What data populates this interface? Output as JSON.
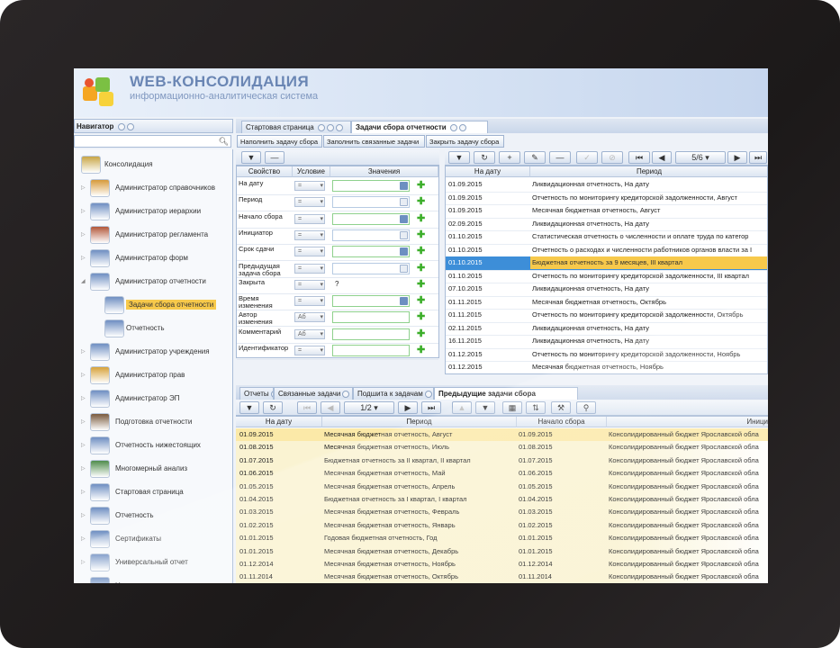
{
  "app": {
    "title": "WEB-КОНСОЛИДАЦИЯ",
    "subtitle": "информационно-аналитическая система"
  },
  "navigator": {
    "title": "Навигатор",
    "items": [
      {
        "label": "Консолидация",
        "icon": "consolidation-icon",
        "color": "#c9a646"
      },
      {
        "label": "Администратор справочников",
        "icon": "admin-user-icon",
        "color": "#d79a3b"
      },
      {
        "label": "Администратор иерархии",
        "icon": "admin-user-icon",
        "color": "#6f8fc2"
      },
      {
        "label": "Администратор регламента",
        "icon": "admin-user-icon",
        "color": "#b2573a"
      },
      {
        "label": "Администратор форм",
        "icon": "admin-user-icon",
        "color": "#6f8fc2"
      },
      {
        "label": "Администратор отчетности",
        "icon": "admin-user-icon",
        "color": "#6f8fc2"
      },
      {
        "label": "Задачи сбора отчетности",
        "icon": "task-icon",
        "color": "#6f8fc2"
      },
      {
        "label": "Отчетность",
        "icon": "report-icon",
        "color": "#6f8fc2"
      },
      {
        "label": "Администратор учреждения",
        "icon": "admin-user-icon",
        "color": "#6f8fc2"
      },
      {
        "label": "Администратор прав",
        "icon": "admin-user-icon",
        "color": "#d7a23b"
      },
      {
        "label": "Администратор ЭП",
        "icon": "admin-user-icon",
        "color": "#6f8fc2"
      },
      {
        "label": "Подготовка отчетности",
        "icon": "prepare-icon",
        "color": "#7a5a3e"
      },
      {
        "label": "Отчетность нижестоящих",
        "icon": "tree-icon",
        "color": "#6f8fc2"
      },
      {
        "label": "Многомерный анализ",
        "icon": "cube-icon",
        "color": "#4f8c4c"
      },
      {
        "label": "Стартовая страница",
        "icon": "home-icon",
        "color": "#6f8fc2"
      },
      {
        "label": "Отчетность",
        "icon": "report-icon",
        "color": "#6f8fc2"
      },
      {
        "label": "Сертификаты",
        "icon": "certificate-icon",
        "color": "#6f8fc2"
      },
      {
        "label": "Универсальный отчет",
        "icon": "table-icon",
        "color": "#6f8fc2"
      },
      {
        "label": "Новости",
        "icon": "news-icon",
        "color": "#6f8fc2"
      }
    ]
  },
  "tabs": {
    "start": "Стартовая страница",
    "tasks": "Задачи сбора отчетности"
  },
  "actions": {
    "fill": "Наполнить задачу сбора",
    "fill_related": "Заполнить связанные задачи",
    "close": "Закрыть задачу сбора"
  },
  "filter": {
    "columns": [
      "Свойство",
      "Условие",
      "Значения"
    ],
    "rows": [
      {
        "prop": "На дату",
        "cond": "=",
        "value": "",
        "kind": "date"
      },
      {
        "prop": "Период",
        "cond": "=",
        "value": "",
        "kind": "select"
      },
      {
        "prop": "Начало сбора",
        "cond": "=",
        "value": "",
        "kind": "date"
      },
      {
        "prop": "Инициатор",
        "cond": "=",
        "value": "",
        "kind": "lookup"
      },
      {
        "prop": "Срок сдачи",
        "cond": "=",
        "value": "",
        "kind": "date"
      },
      {
        "prop": "Предыдущая задача сбора",
        "cond": "=",
        "value": "",
        "kind": "lookup"
      },
      {
        "prop": "Закрыта",
        "cond": "=",
        "value": "?",
        "kind": "bool"
      },
      {
        "prop": "Время изменения",
        "cond": "=",
        "value": "",
        "kind": "date"
      },
      {
        "prop": "Автор изменения",
        "cond": "Аб",
        "value": "",
        "kind": "text"
      },
      {
        "prop": "Комментарий",
        "cond": "Аб",
        "value": "",
        "kind": "text"
      },
      {
        "prop": "Идентификатор",
        "cond": "=",
        "value": "",
        "kind": "text"
      }
    ]
  },
  "pager_top": "5/6",
  "grid_top": {
    "columns": [
      "На дату",
      "Период"
    ],
    "rows": [
      {
        "date": "01.09.2015",
        "period": "Ликвидационная отчетность, На дату"
      },
      {
        "date": "01.09.2015",
        "period": "Отчетность по мониторингу кредиторской задолженности, Август"
      },
      {
        "date": "01.09.2015",
        "period": "Месячная бюджетная отчетность, Август"
      },
      {
        "date": "02.09.2015",
        "period": "Ликвидационная отчетность, На дату"
      },
      {
        "date": "01.10.2015",
        "period": "Статистическая отчетность о численности и оплате труда по категор"
      },
      {
        "date": "01.10.2015",
        "period": "Отчетность о расходах и численности работников органов власти за I"
      },
      {
        "date": "01.10.2015",
        "period": "Бюджетная отчетность за 9 месяцев, III квартал"
      },
      {
        "date": "01.10.2015",
        "period": "Отчетность по мониторингу кредиторской задолженности, III квартал"
      },
      {
        "date": "07.10.2015",
        "period": "Ликвидационная отчетность, На дату"
      },
      {
        "date": "01.11.2015",
        "period": "Месячная бюджетная отчетность, Октябрь"
      },
      {
        "date": "01.11.2015",
        "period": "Отчетность по мониторингу кредиторской задолженности, Октябрь"
      },
      {
        "date": "02.11.2015",
        "period": "Ликвидационная отчетность, На дату"
      },
      {
        "date": "16.11.2015",
        "period": "Ликвидационная отчетность, На дату"
      },
      {
        "date": "01.12.2015",
        "period": "Отчетность по мониторингу кредиторской задолженности, Ноябрь"
      },
      {
        "date": "01.12.2015",
        "period": "Месячная бюджетная отчетность, Ноябрь"
      }
    ],
    "selected_index": 6
  },
  "bottom_tabs": [
    "Отчеты",
    "Связанные задачи",
    "Подшита к задачам",
    "Предыдущие задачи сбора"
  ],
  "pager_bottom": "1/2",
  "grid_bottom": {
    "columns": [
      "На дату",
      "Период",
      "Начало сбора",
      "Иници"
    ],
    "rows": [
      {
        "date": "01.09.2015",
        "period": "Месячная бюджетная отчетность, Август",
        "start": "01.09.2015",
        "init": "Консолидированный бюджет Ярославской обла"
      },
      {
        "date": "01.08.2015",
        "period": "Месячная бюджетная отчетность, Июль",
        "start": "01.08.2015",
        "init": "Консолидированный бюджет Ярославской обла"
      },
      {
        "date": "01.07.2015",
        "period": "Бюджетная отчетность за II квартал, II квартал",
        "start": "01.07.2015",
        "init": "Консолидированный бюджет Ярославской обла"
      },
      {
        "date": "01.06.2015",
        "period": "Месячная бюджетная отчетность, Май",
        "start": "01.06.2015",
        "init": "Консолидированный бюджет Ярославской обла"
      },
      {
        "date": "01.05.2015",
        "period": "Месячная бюджетная отчетность, Апрель",
        "start": "01.05.2015",
        "init": "Консолидированный бюджет Ярославской обла"
      },
      {
        "date": "01.04.2015",
        "period": "Бюджетная отчетность за I квартал, I квартал",
        "start": "01.04.2015",
        "init": "Консолидированный бюджет Ярославской обла"
      },
      {
        "date": "01.03.2015",
        "period": "Месячная бюджетная отчетность, Февраль",
        "start": "01.03.2015",
        "init": "Консолидированный бюджет Ярославской обла"
      },
      {
        "date": "01.02.2015",
        "period": "Месячная бюджетная отчетность, Январь",
        "start": "01.02.2015",
        "init": "Консолидированный бюджет Ярославской обла"
      },
      {
        "date": "01.01.2015",
        "period": "Годовая бюджетная отчетность, Год",
        "start": "01.01.2015",
        "init": "Консолидированный бюджет Ярославской обла"
      },
      {
        "date": "01.01.2015",
        "period": "Месячная бюджетная отчетность, Декабрь",
        "start": "01.01.2015",
        "init": "Консолидированный бюджет Ярославской обла"
      },
      {
        "date": "01.12.2014",
        "period": "Месячная бюджетная отчетность, Ноябрь",
        "start": "01.12.2014",
        "init": "Консолидированный бюджет Ярославской обла"
      },
      {
        "date": "01.11.2014",
        "period": "Месячная бюджетная отчетность, Октябрь",
        "start": "01.11.2014",
        "init": "Консолидированный бюджет Ярославской обла"
      }
    ]
  },
  "colors": {
    "accent": "#f7c94b",
    "selection": "#3d8ed8",
    "row_highlight": "#faf3d2"
  }
}
